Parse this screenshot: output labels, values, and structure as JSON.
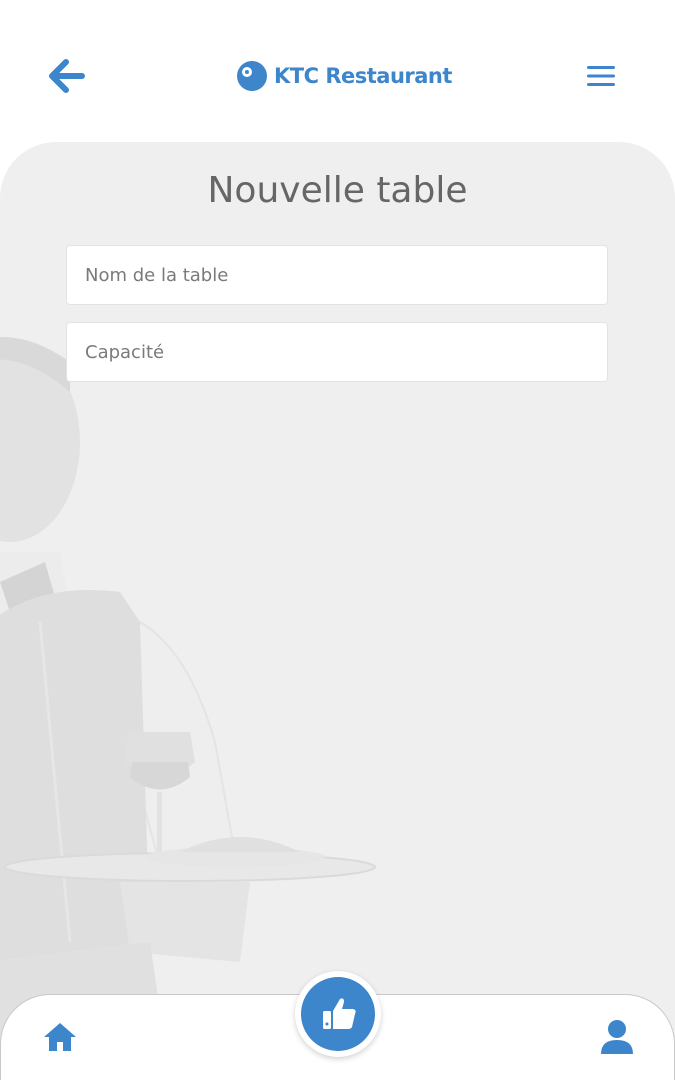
{
  "header": {
    "brand_name": "KTC Restaurant",
    "back_icon": "arrow-left-icon",
    "menu_icon": "hamburger-menu-icon",
    "logo_icon": "ktc-logo-icon"
  },
  "main": {
    "title": "Nouvelle table",
    "fields": {
      "name": {
        "placeholder": "Nom de la table",
        "value": ""
      },
      "capacity": {
        "placeholder": "Capacité",
        "value": ""
      }
    }
  },
  "bottom_nav": {
    "home_icon": "home-icon",
    "center_icon": "thumbs-up-icon",
    "profile_icon": "user-icon"
  },
  "colors": {
    "accent": "#3d86cb",
    "panel_background": "#efefef",
    "title_text": "#666666"
  }
}
